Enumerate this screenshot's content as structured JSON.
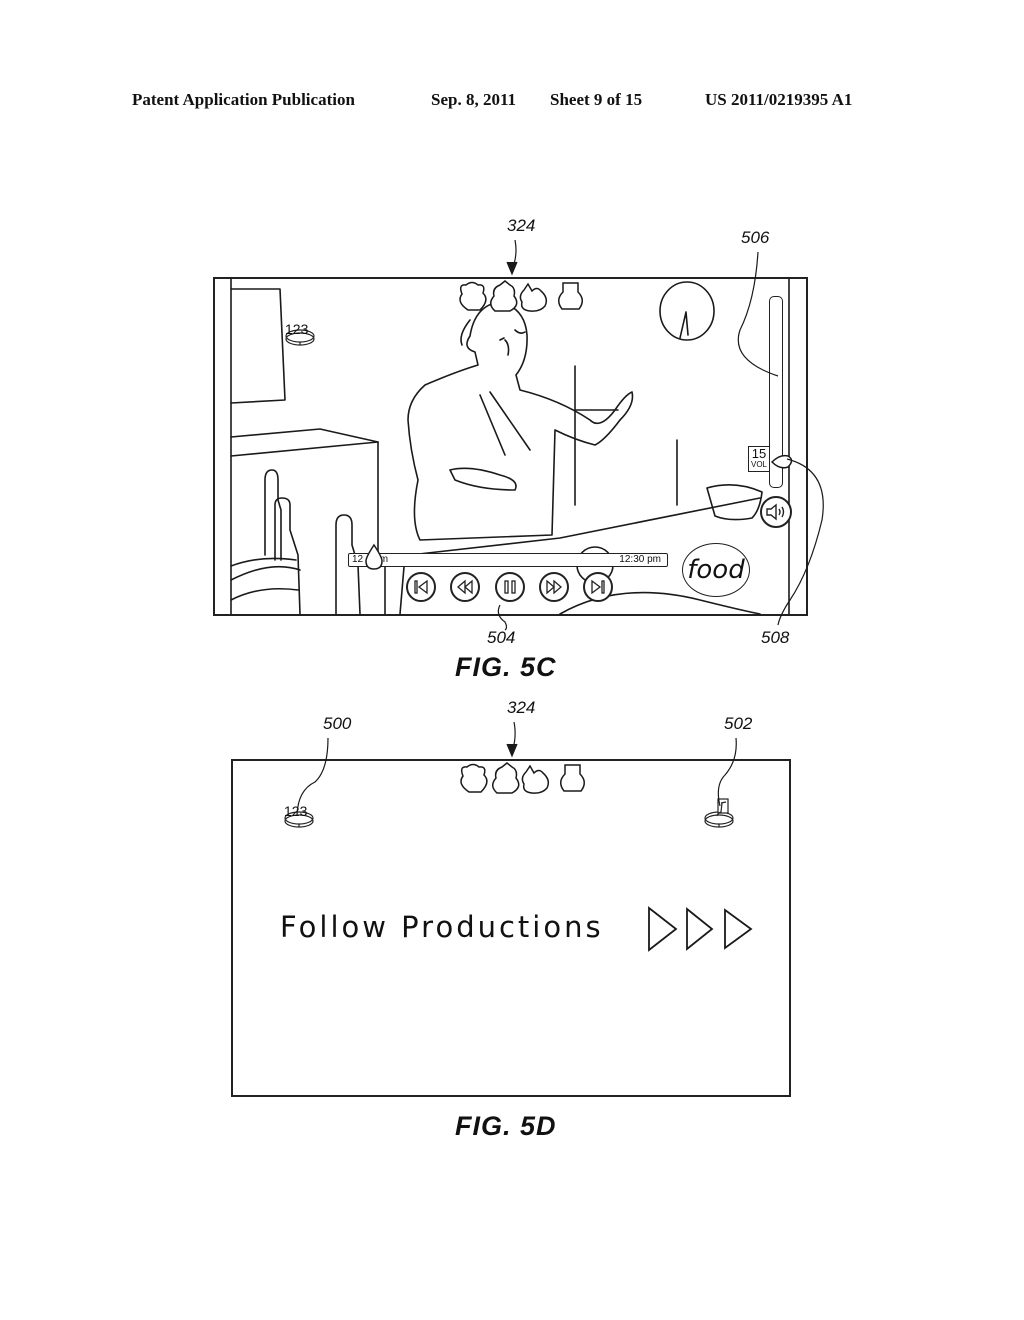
{
  "header": {
    "publication": "Patent Application Publication",
    "date": "Sep. 8, 2011",
    "sheet": "Sheet 9 of 15",
    "number": "US 2011/0219395 A1"
  },
  "fig5c": {
    "caption": "FIG. 5C",
    "refs": {
      "screen": "324",
      "volume_slider": "506",
      "playback_controls": "504",
      "volume_indicator": "508"
    },
    "channel_badge": "123",
    "playback": {
      "start_time": "12:00 pm",
      "start_time_visible": "12",
      "start_time_suffix": "pm",
      "end_time": "12:30 pm",
      "progress_percent": 5,
      "buttons": [
        "skip-back",
        "rewind",
        "pause",
        "fast-forward",
        "skip-forward"
      ]
    },
    "volume": {
      "value": "15",
      "label": "VOL",
      "level_fraction": 0.15
    },
    "food_logo": "food"
  },
  "fig5d": {
    "caption": "FIG. 5D",
    "refs": {
      "screen": "324",
      "channel_icon": "500",
      "music_icon": "502"
    },
    "channel_badge": "123",
    "message": "Follow Productions",
    "arrow_count": 3
  }
}
